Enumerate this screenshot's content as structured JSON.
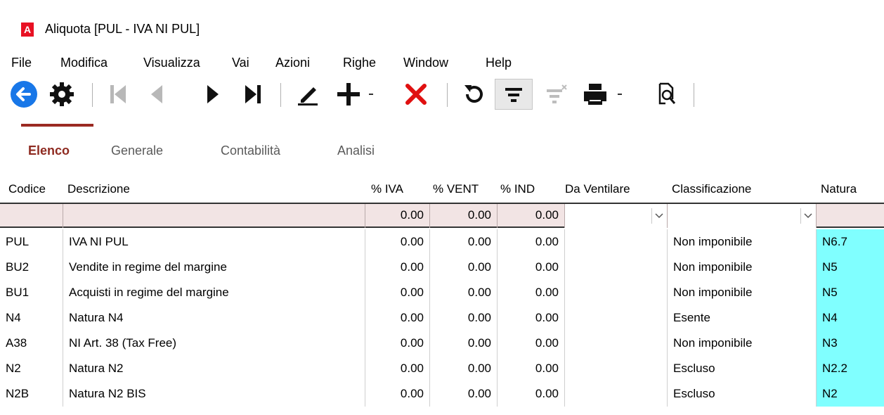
{
  "window": {
    "app_icon_letter": "A",
    "title": "Aliquota [PUL - IVA NI PUL]"
  },
  "menu": [
    "File",
    "Modifica",
    "Visualizza",
    "Vai",
    "Azioni",
    "Righe",
    "Window",
    "Help"
  ],
  "toolbar": {
    "icons": [
      "back-icon",
      "settings-icon",
      "first-record-icon",
      "previous-record-icon",
      "next-record-icon",
      "last-record-icon",
      "edit-icon",
      "add-icon",
      "delete-icon",
      "refresh-icon",
      "filter-icon",
      "clear-filter-icon",
      "print-icon",
      "preview-icon"
    ]
  },
  "tabs": [
    {
      "label": "Elenco",
      "active": true
    },
    {
      "label": "Generale",
      "active": false
    },
    {
      "label": "Contabilità",
      "active": false
    },
    {
      "label": "Analisi",
      "active": false
    }
  ],
  "table": {
    "columns": [
      "Codice",
      "Descrizione",
      "% IVA",
      "% VENT",
      "% IND",
      "Da Ventilare",
      "Classificazione",
      "Natura"
    ],
    "filter": {
      "iva": "0.00",
      "vent": "0.00",
      "ind": "0.00",
      "da_ventilare": "",
      "classificazione": ""
    },
    "rows": [
      {
        "codice": "PUL",
        "descrizione": "IVA NI PUL",
        "iva": "0.00",
        "vent": "0.00",
        "ind": "0.00",
        "da_ventilare": "",
        "classificazione": "Non imponibile",
        "natura": "N6.7"
      },
      {
        "codice": "BU2",
        "descrizione": "Vendite in regime del margine",
        "iva": "0.00",
        "vent": "0.00",
        "ind": "0.00",
        "da_ventilare": "",
        "classificazione": "Non imponibile",
        "natura": "N5"
      },
      {
        "codice": "BU1",
        "descrizione": "Acquisti in regime del margine",
        "iva": "0.00",
        "vent": "0.00",
        "ind": "0.00",
        "da_ventilare": "",
        "classificazione": "Non imponibile",
        "natura": "N5"
      },
      {
        "codice": "N4",
        "descrizione": "Natura N4",
        "iva": "0.00",
        "vent": "0.00",
        "ind": "0.00",
        "da_ventilare": "",
        "classificazione": "Esente",
        "natura": "N4"
      },
      {
        "codice": "A38",
        "descrizione": "NI Art. 38 (Tax Free)",
        "iva": "0.00",
        "vent": "0.00",
        "ind": "0.00",
        "da_ventilare": "",
        "classificazione": "Non imponibile",
        "natura": "N3"
      },
      {
        "codice": "N2",
        "descrizione": "Natura N2",
        "iva": "0.00",
        "vent": "0.00",
        "ind": "0.00",
        "da_ventilare": "",
        "classificazione": "Escluso",
        "natura": "N2.2"
      },
      {
        "codice": "N2B",
        "descrizione": "Natura N2 BIS",
        "iva": "0.00",
        "vent": "0.00",
        "ind": "0.00",
        "da_ventilare": "",
        "classificazione": "Escluso",
        "natura": "N2"
      }
    ]
  },
  "colors": {
    "accent": "#9b2a22",
    "back_button": "#1877e8",
    "delete": "#e01010",
    "natura_highlight": "#80ffff",
    "filter_row": "#f2e4e4"
  }
}
